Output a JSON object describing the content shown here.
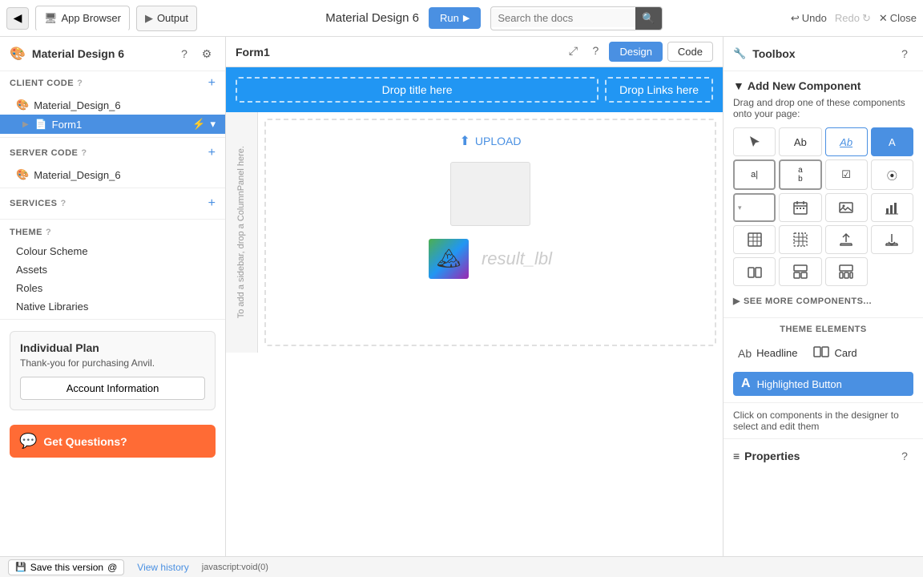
{
  "topbar": {
    "nav_back_label": "◀",
    "tab_app_browser_label": "App Browser",
    "tab_output_label": "Output",
    "app_title": "Material Design 6",
    "run_button_label": "Run",
    "search_placeholder": "Search the docs",
    "search_icon": "🔍",
    "undo_label": "Undo",
    "redo_label": "Redo",
    "close_label": "Close",
    "undo_icon": "↩",
    "redo_icon": "↻",
    "close_icon": "✕"
  },
  "left_panel": {
    "title": "Material Design 6",
    "help_icon": "?",
    "settings_icon": "⚙",
    "client_code_label": "CLIENT CODE",
    "client_code_help": "?",
    "client_add": "+",
    "material_design_6_label": "Material_Design_6",
    "form1_label": "Form1",
    "server_code_label": "SERVER CODE",
    "server_code_help": "?",
    "server_add": "+",
    "server_material_label": "Material_Design_6",
    "services_label": "SERVICES",
    "services_help": "?",
    "services_add": "+",
    "theme_label": "THEME",
    "theme_help": "?",
    "colour_scheme_label": "Colour Scheme",
    "assets_label": "Assets",
    "roles_label": "Roles",
    "native_libraries_label": "Native Libraries",
    "plan_title": "Individual Plan",
    "plan_desc": "Thank-you for purchasing Anvil.",
    "account_btn_label": "Account Information",
    "get_questions_label": "Get Questions?"
  },
  "center": {
    "form_title": "Form1",
    "design_btn_label": "Design",
    "code_btn_label": "Code",
    "expand_icon": "⤢",
    "help_icon": "?",
    "drop_title_label": "Drop title here",
    "drop_links_label": "Drop Links here",
    "upload_label": "UPLOAD",
    "sidebar_drop_text": "To add a sidebar, drop a ColumnPanel here.",
    "result_label": "result_lbl"
  },
  "toolbox": {
    "title": "Toolbox",
    "help_icon": "?",
    "add_component_title": "Add New Component",
    "add_component_desc": "Drag and drop one of these components onto your page:",
    "components": [
      {
        "id": "cursor",
        "symbol": "▲",
        "label": "Cursor"
      },
      {
        "id": "text",
        "symbol": "Ab",
        "label": "Text"
      },
      {
        "id": "link",
        "symbol": "Ab",
        "label": "Link",
        "style": "outlined"
      },
      {
        "id": "button",
        "symbol": "A",
        "label": "Button",
        "style": "highlighted"
      },
      {
        "id": "textbox",
        "symbol": "a|",
        "label": "TextBox"
      },
      {
        "id": "textbox2",
        "symbol": "a\nb",
        "label": "TextBox Multiline"
      },
      {
        "id": "checkbox",
        "symbol": "☑",
        "label": "Checkbox"
      },
      {
        "id": "radio",
        "symbol": "⦿",
        "label": "Radio"
      },
      {
        "id": "dropdown",
        "symbol": "▼",
        "label": "Dropdown"
      },
      {
        "id": "datepicker",
        "symbol": "📅",
        "label": "DatePicker"
      },
      {
        "id": "image",
        "symbol": "🖼",
        "label": "Image"
      },
      {
        "id": "plot",
        "symbol": "📊",
        "label": "Plot"
      },
      {
        "id": "datagrid",
        "symbol": "⊞",
        "label": "DataGrid"
      },
      {
        "id": "datagrid2",
        "symbol": "⊟",
        "label": "DataGrid2"
      },
      {
        "id": "upload_btn",
        "symbol": "⬆",
        "label": "Upload"
      },
      {
        "id": "download_btn",
        "symbol": "⬇",
        "label": "Download"
      },
      {
        "id": "col1",
        "symbol": "⊞",
        "label": "Column1"
      },
      {
        "id": "col2",
        "symbol": "⊞",
        "label": "Column2"
      },
      {
        "id": "col3",
        "symbol": "⊞",
        "label": "Column3"
      }
    ],
    "see_more_label": "SEE MORE COMPONENTS...",
    "theme_elements_title": "THEME ELEMENTS",
    "theme_elements": [
      {
        "id": "headline",
        "icon_label": "Ab",
        "label": "Headline"
      },
      {
        "id": "card",
        "icon_label": "⊞",
        "label": "Card"
      }
    ],
    "highlighted_btn_label": "Highlighted Button",
    "hint": "Click on components in the designer to select and edit them"
  },
  "properties": {
    "title": "Properties",
    "help_icon": "?"
  },
  "bottom_bar": {
    "save_version_label": "Save this version",
    "save_icon": "💾",
    "view_history_label": "View history",
    "js_status": "javascript:void(0)"
  }
}
